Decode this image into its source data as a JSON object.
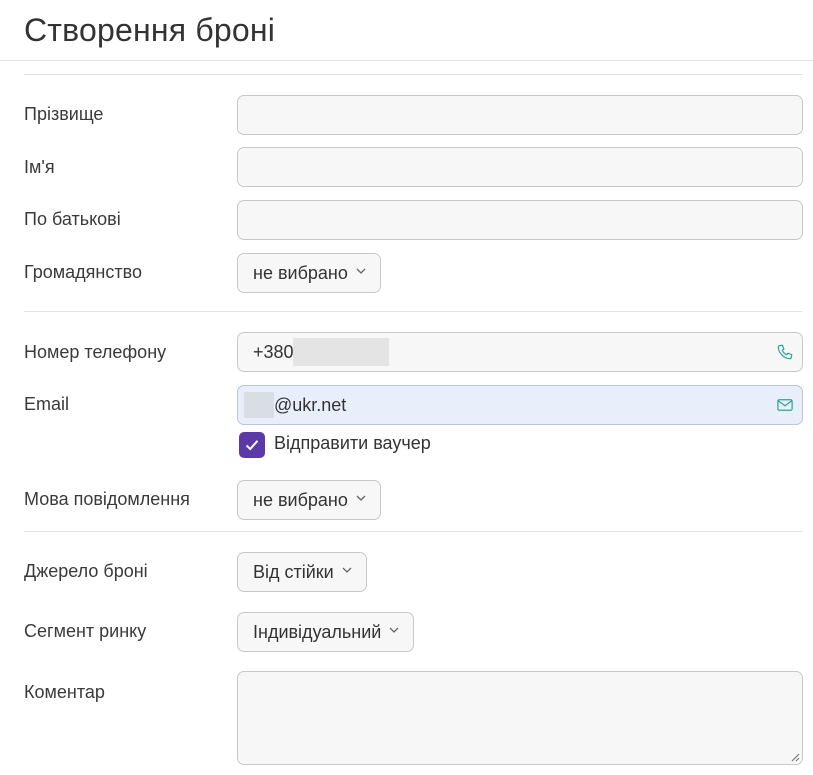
{
  "page_title": "Створення броні",
  "fields": {
    "surname": {
      "label": "Прізвище",
      "value": ""
    },
    "first_name": {
      "label": "Ім'я",
      "value": ""
    },
    "patronymic": {
      "label": "По батькові",
      "value": ""
    },
    "citizenship": {
      "label": "Громадянство",
      "value": "не вибрано"
    },
    "phone": {
      "label": "Номер телефону",
      "value": "+380"
    },
    "email": {
      "label": "Email",
      "value": "@ukr.net"
    },
    "send_voucher": {
      "label": "Відправити ваучер",
      "checked": true
    },
    "message_language": {
      "label": "Мова повідомлення",
      "value": "не вибрано"
    },
    "booking_source": {
      "label": "Джерело броні",
      "value": "Від стійки"
    },
    "market_segment": {
      "label": "Сегмент ринку",
      "value": "Індивідуальний"
    },
    "comment": {
      "label": "Коментар",
      "value": ""
    }
  },
  "colors": {
    "accent": "#5b3aa8",
    "icon_teal": "#2aa58f",
    "focus_bg": "#e8effb"
  },
  "icons": {
    "phone": "phone-icon",
    "email": "mail-icon",
    "dropdown": "chevron-down-icon",
    "check": "check-icon",
    "resize": "resize-grip-icon"
  }
}
